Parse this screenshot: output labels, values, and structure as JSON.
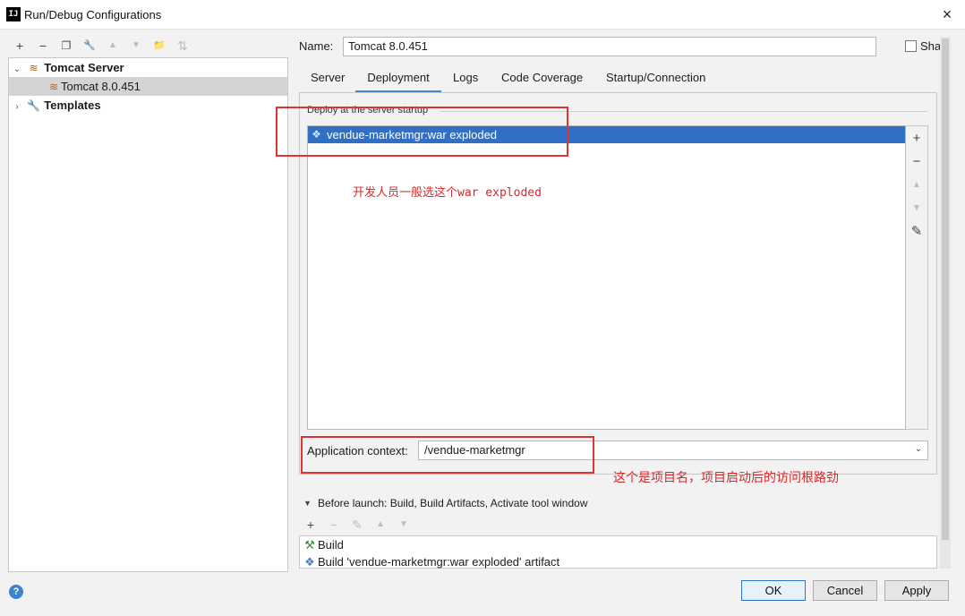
{
  "window": {
    "app_icon": "IJ",
    "title": "Run/Debug Configurations",
    "close_icon": "×"
  },
  "left_toolbar": {
    "add": "+",
    "remove": "−",
    "copy": "❐",
    "edit_defaults": "🔧",
    "move_up": "▲",
    "move_down": "▼",
    "folder": "📁",
    "sort": "⇅"
  },
  "tree": {
    "items": [
      {
        "label": "Tomcat Server",
        "expanded": true,
        "icon": "tomcat-icon"
      },
      {
        "label": "Tomcat 8.0.451",
        "selected": true,
        "icon": "tomcat-icon"
      },
      {
        "label": "Templates",
        "expanded": false,
        "icon": "wrench-icon"
      }
    ],
    "expanded_caret": "⌄",
    "collapsed_caret": "›"
  },
  "form": {
    "name_label": "Name:",
    "name_value": "Tomcat 8.0.451",
    "share_label": "Share",
    "share_checked": false
  },
  "tabs": [
    {
      "label": "Server",
      "active": false
    },
    {
      "label": "Deployment",
      "active": true
    },
    {
      "label": "Logs",
      "active": false
    },
    {
      "label": "Code Coverage",
      "active": false
    },
    {
      "label": "Startup/Connection",
      "active": false
    }
  ],
  "deployment": {
    "section_label": "Deploy at the server startup",
    "artifacts": [
      {
        "label": "vendue-marketmgr:war exploded",
        "selected": true
      }
    ],
    "side_buttons": {
      "add": "+",
      "remove": "−",
      "up": "▲",
      "down": "▼",
      "edit": "✎"
    },
    "context_label": "Application context:",
    "context_value": "/vendue-marketmgr",
    "dropdown_arrow": "⌄"
  },
  "annotations": {
    "note_artifact": "开发人员一般选这个war exploded",
    "note_context": "这个是项目名，项目启动后的访问根路劲"
  },
  "before_launch": {
    "caret": "▼",
    "label": "Before launch: Build, Build Artifacts, Activate tool window",
    "toolbar": {
      "add": "+",
      "remove": "−",
      "edit": "✎",
      "up": "▲",
      "down": "▼"
    },
    "tasks": [
      {
        "label": "Build",
        "icon": "hammer-icon"
      },
      {
        "label": "Build 'vendue-marketmgr:war exploded' artifact",
        "icon": "artifact-icon"
      }
    ]
  },
  "footer": {
    "help_icon": "?",
    "ok": "OK",
    "cancel": "Cancel",
    "apply": "Apply"
  },
  "colors": {
    "selection": "#2f6fc6",
    "tab_underline": "#4a88c7",
    "annotation_red": "#e03434"
  }
}
